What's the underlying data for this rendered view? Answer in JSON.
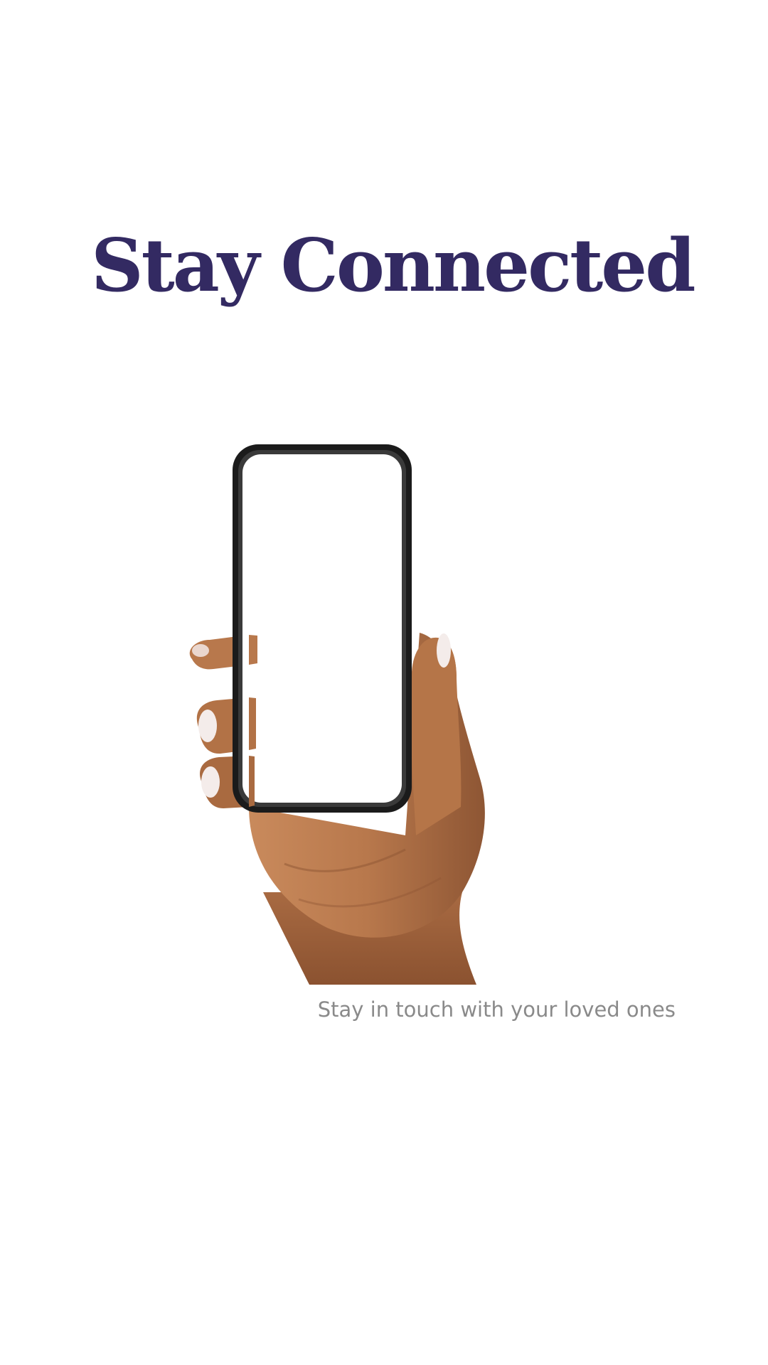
{
  "onboarding": {
    "title": "Stay Connected",
    "subtitle": "Stay in touch with your loved ones"
  },
  "illustration": {
    "icon": "hand-holding-phone-icon"
  },
  "colors": {
    "background": "#ffffff",
    "title": "#332a62",
    "subtitle": "#8a8a8a",
    "skin": "#b8784c",
    "nail": "#f4ecea",
    "phone_frame": "#1b1b1b"
  }
}
